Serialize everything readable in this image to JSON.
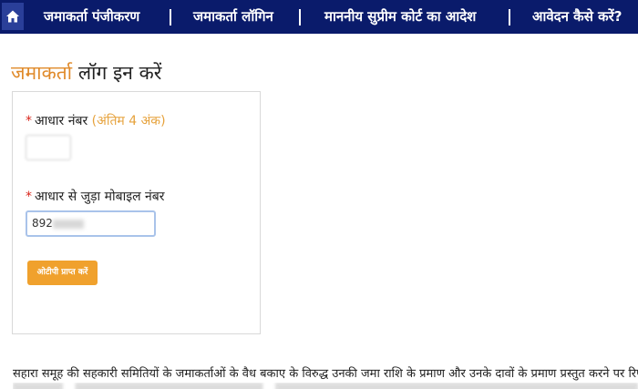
{
  "nav": {
    "items": [
      {
        "label": "जमाकर्ता पंजीकरण"
      },
      {
        "label": "जमाकर्ता लॉगिन"
      },
      {
        "label": "माननीय सुप्रीम कोर्ट का आदेश"
      },
      {
        "label": "आवेदन कैसे करें?"
      }
    ]
  },
  "page": {
    "title_accent": "जमाकर्ता",
    "title_rest": "लॉग इन करें"
  },
  "form": {
    "aadhaar_label": "आधार नंबर",
    "aadhaar_hint": "(अंतिम 4 अंक)",
    "mobile_label": "आधार से जुड़ा मोबाइल नंबर",
    "mobile_value_prefix": "892",
    "submit_label": "ओटीपी प्राप्त करें",
    "required_mark": "*"
  },
  "notice": {
    "text": "सहारा समूह की सहकारी समितियों के जमाकर्ताओं के वैध बकाए के विरुद्ध उनकी जमा राशि के प्रमाण और उनके दावों के प्रमाण प्रस्तुत करने पर रिफंड राशि"
  },
  "colors": {
    "nav_bg": "#0a1b6b",
    "accent": "#e08a2a",
    "button": "#f0a12d",
    "required": "#d9261c"
  }
}
